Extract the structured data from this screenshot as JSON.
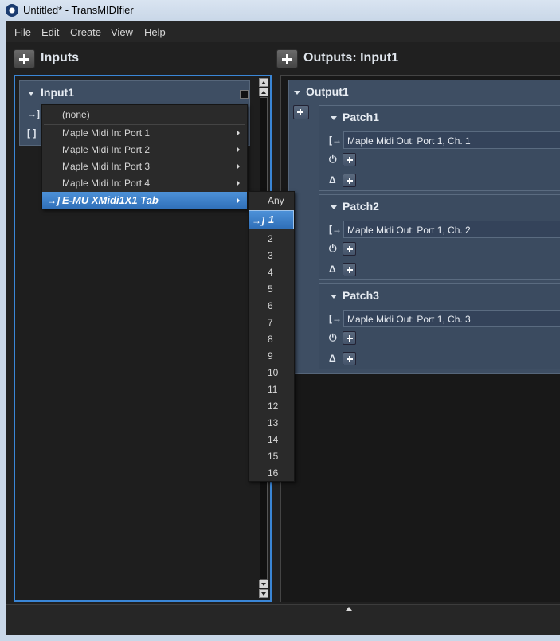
{
  "window": {
    "title": "Untitled* - TransMIDIfier"
  },
  "menubar": {
    "items": [
      "File",
      "Edit",
      "Create",
      "View",
      "Help"
    ]
  },
  "inputs": {
    "heading": "Inputs",
    "card": {
      "name": "Input1",
      "row1_icon": "→]",
      "row2_icon": "[ ]"
    }
  },
  "outputs": {
    "heading": "Outputs: Input1",
    "card": {
      "name": "Output1",
      "patches": [
        {
          "name": "Patch1",
          "destination": "Maple Midi Out: Port 1, Ch. 1"
        },
        {
          "name": "Patch2",
          "destination": "Maple Midi Out: Port 1, Ch. 2"
        },
        {
          "name": "Patch3",
          "destination": "Maple Midi Out: Port 1, Ch. 3"
        }
      ]
    }
  },
  "context_menu": {
    "items": [
      {
        "label": "(none)"
      },
      {
        "label": "Maple Midi In: Port 1"
      },
      {
        "label": "Maple Midi In: Port 2"
      },
      {
        "label": "Maple Midi In: Port 3"
      },
      {
        "label": "Maple Midi In: Port 4"
      },
      {
        "label": "E-MU XMidi1X1 Tab"
      }
    ]
  },
  "channel_submenu": {
    "items": [
      "Any",
      "1",
      "2",
      "3",
      "4",
      "5",
      "6",
      "7",
      "8",
      "9",
      "10",
      "11",
      "12",
      "13",
      "14",
      "15",
      "16"
    ],
    "selected": "1"
  },
  "colors": {
    "accent": "#3a86d6",
    "card": "#3e4e63",
    "highlight": "#2f6fb8"
  }
}
